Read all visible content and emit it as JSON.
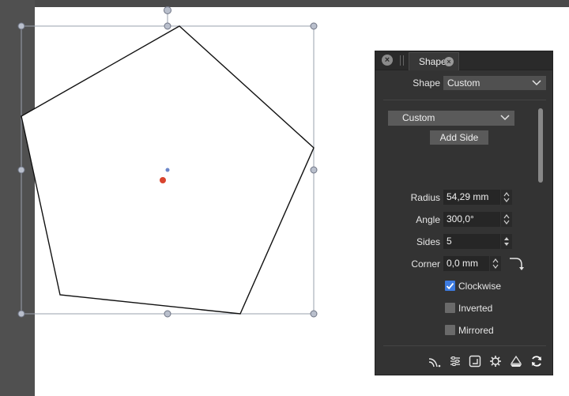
{
  "panel": {
    "tab_label": "Shape",
    "shape_label": "Shape",
    "shape_value": "Custom",
    "side_type_value": "Custom",
    "add_side_label": "Add Side",
    "radius_label": "Radius",
    "radius_value": "54,29 mm",
    "angle_label": "Angle",
    "angle_value": "300,0°",
    "sides_label": "Sides",
    "sides_value": "5",
    "corner_label": "Corner",
    "corner_value": "0,0 mm",
    "clockwise_label": "Clockwise",
    "clockwise_checked": true,
    "inverted_label": "Inverted",
    "inverted_checked": false,
    "mirrored_label": "Mirrored",
    "mirrored_checked": false
  },
  "icons": [
    "close-icon",
    "chevron-down-icon",
    "corner-curve-icon",
    "checkmark-icon",
    "path-icon",
    "sliders-icon",
    "corner-box-icon",
    "gear-icon",
    "shape-stack-icon",
    "refresh-icon"
  ],
  "colors": {
    "accent": "#3d7be0",
    "panel_bg": "#333333",
    "canvas_bg": "#ffffff",
    "center_dot": "#d9452f",
    "handle_dot": "#6b86c9"
  }
}
